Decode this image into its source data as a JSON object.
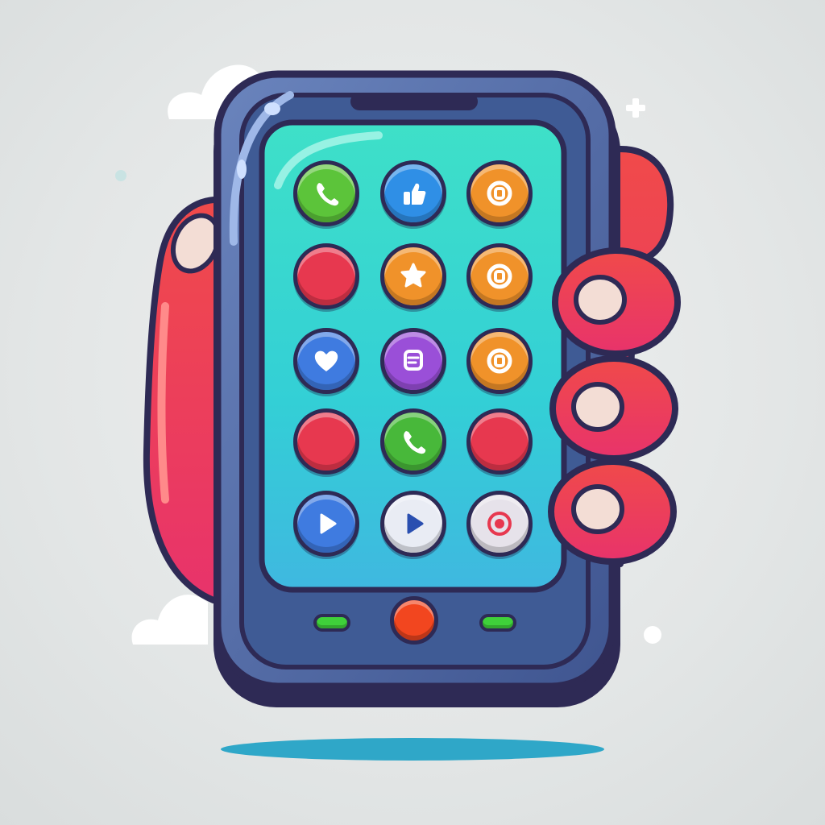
{
  "colors": {
    "background": "#e3e6e6",
    "outline": "#2e2a55",
    "phone_body": "#4a5f8f",
    "phone_rim": "#5f7fbf",
    "screen": "#36d6c6",
    "hand": "#ee3a4a",
    "fingernail": "#f3ddd5",
    "shadow": "#2fa7c8"
  },
  "apps": [
    {
      "icon": "phone-icon",
      "color": "#5cc43a"
    },
    {
      "icon": "thumbs-up-icon",
      "color": "#2f8fe6"
    },
    {
      "icon": "target-icon",
      "color": "#f0922a"
    },
    {
      "icon": "heart-icon",
      "color": "#e7384f"
    },
    {
      "icon": "star-icon",
      "color": "#f0922a"
    },
    {
      "icon": "target-icon",
      "color": "#f0922a"
    },
    {
      "icon": "heart-icon",
      "color": "#3f7be0"
    },
    {
      "icon": "chat-icon",
      "color": "#9a4fd8"
    },
    {
      "icon": "target-icon",
      "color": "#f0922a"
    },
    {
      "icon": "heart-icon",
      "color": "#e7384f"
    },
    {
      "icon": "phone-icon",
      "color": "#48b83a"
    },
    {
      "icon": "record-icon",
      "color": "#e7384f"
    },
    {
      "icon": "play-icon",
      "color": "#3f7be0"
    },
    {
      "icon": "play-icon",
      "color": "#e9ecf4"
    },
    {
      "icon": "record-icon",
      "color": "#e6e2ea"
    }
  ],
  "hardware_buttons": {
    "left": {
      "color": "#3fd13a"
    },
    "center": {
      "color": "#f2461f"
    },
    "right": {
      "color": "#3fd13a"
    }
  }
}
